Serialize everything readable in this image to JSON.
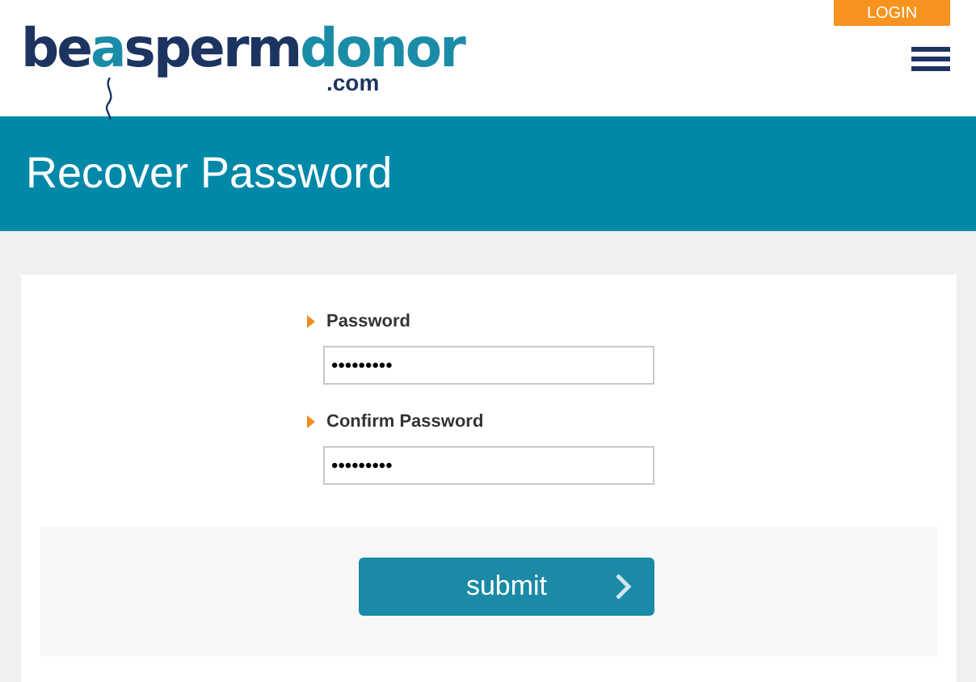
{
  "header": {
    "logo": {
      "parts": [
        {
          "text": "be",
          "color": "#1d3461"
        },
        {
          "text": "a",
          "color": "#1a8ca8"
        },
        {
          "text": "sperm",
          "color": "#1d3461"
        },
        {
          "text": "donor",
          "color": "#1a8ca8"
        }
      ],
      "domain": ".com"
    },
    "login_button": "LOGIN"
  },
  "page_title": "Recover Password",
  "form": {
    "fields": [
      {
        "label": "Password",
        "value": "•••••••••"
      },
      {
        "label": "Confirm Password",
        "value": "•••••••••"
      }
    ],
    "submit_button": "submit"
  }
}
